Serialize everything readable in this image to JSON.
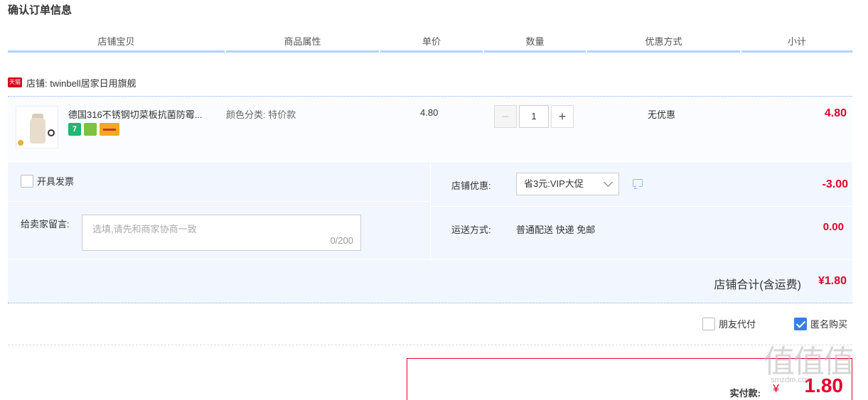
{
  "page_title": "确认订单信息",
  "columns": [
    "店铺宝贝",
    "商品属性",
    "单价",
    "数量",
    "优惠方式",
    "小计"
  ],
  "shop": {
    "badge": "天猫",
    "label": "店铺: twinbell居家日用旗舰"
  },
  "item": {
    "title": "德国316不锈钢切菜板抗菌防霉...",
    "attribute": "颜色分类: 特价款",
    "unit_price": "4.80",
    "quantity": "1",
    "minus": "−",
    "plus": "+",
    "promotion": "无优惠",
    "subtotal": "4.80",
    "service_icons": [
      "7",
      "shield-icon",
      "card-icon"
    ]
  },
  "invoice_label": "开具发票",
  "memo": {
    "label": "给卖家留言:",
    "placeholder": "选填,请先和商家协商一致",
    "counter": "0/200"
  },
  "shop_promo": {
    "label": "店铺优惠:",
    "selected": "省3元:VIP大促",
    "amount": "-3.00"
  },
  "shipping": {
    "label": "运送方式:",
    "value": "普通配送 快递 免邮",
    "amount": "0.00"
  },
  "shop_total": {
    "label": "店铺合计(含运费)",
    "amount": "¥1.80"
  },
  "friend_pay_label": "朋友代付",
  "anonymous_label": "匿名购买",
  "anonymous_checked": true,
  "payment": {
    "label": "实付款:",
    "currency": "¥",
    "amount": "1.80"
  },
  "watermark": {
    "text": "值值值",
    "sub": "smzdm.com"
  },
  "colors": {
    "accent_red": "#e4002b",
    "header_line": "#b2d1ff",
    "section_bg": "#f2f7ff",
    "checkbox_blue": "#3b7de8"
  }
}
